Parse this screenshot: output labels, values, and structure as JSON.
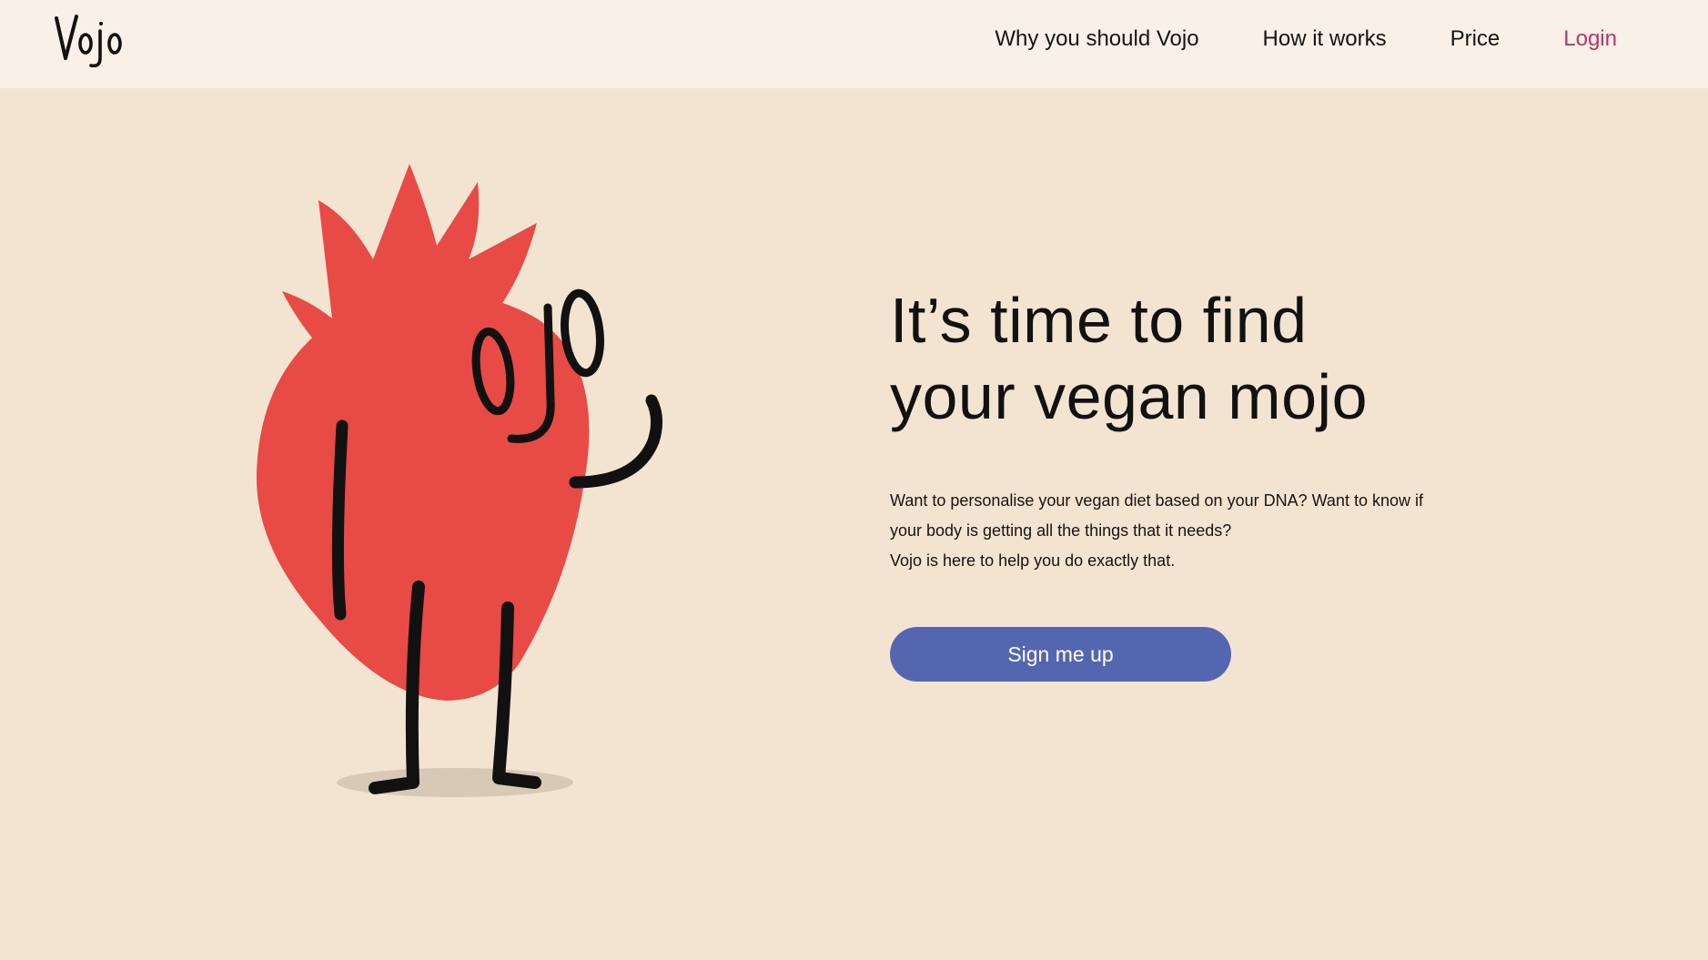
{
  "brand": {
    "logo_text": "Vojo"
  },
  "nav": {
    "items": [
      {
        "label": "Why you should Vojo"
      },
      {
        "label": "How it works"
      },
      {
        "label": "Price"
      },
      {
        "label": "Login"
      }
    ]
  },
  "hero": {
    "headline_line1": "It’s time to find",
    "headline_line2": "your vegan mojo",
    "description_line1": "Want to personalise your vegan diet based on your DNA? Want to know if",
    "description_line2": "your body is getting all the things that it needs?",
    "description_line3": "Vojo is here to help you do exactly that.",
    "cta_label": "Sign me up",
    "mascot_face_text": "ojo"
  },
  "colors": {
    "header_bg": "#f9f1e7",
    "page_bg": "#f3e4d2",
    "login_link": "#b8356b",
    "cta_bg": "#5566b0",
    "mascot_red": "#e84a45",
    "ink": "#111111"
  },
  "icons": {
    "logo": "vojo-wordmark",
    "mascot": "strawberry-mascot-illustration"
  }
}
